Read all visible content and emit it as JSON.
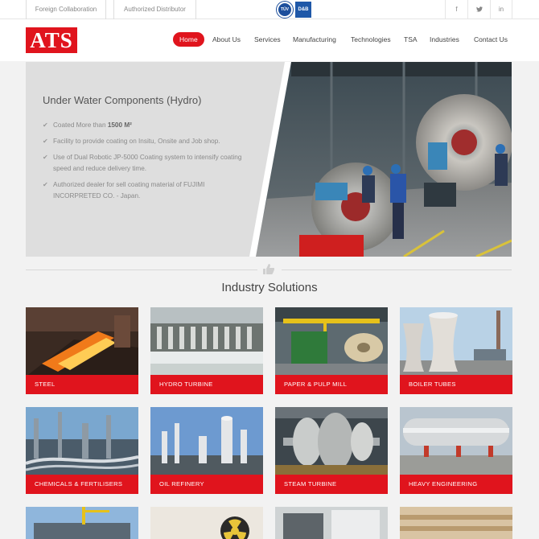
{
  "topbar": {
    "links": [
      "Foreign Collaboration",
      "Authorized Distributor"
    ],
    "certs": [
      "TÜV",
      "D&B"
    ],
    "social": [
      "f",
      "t",
      "in"
    ]
  },
  "header": {
    "logo": "ATS",
    "nav": [
      "Home",
      "About Us",
      "Services",
      "Manufacturing",
      "Technologies",
      "TSA",
      "Industries",
      "Contact Us"
    ],
    "active_nav": "Home"
  },
  "hero": {
    "title": "Under Water Components (Hydro)",
    "bullets": [
      {
        "pre": "Coated More than ",
        "bold": "1500 M²",
        "post": ""
      },
      {
        "pre": "Facility to provide coating on Insitu, Onsite and Job shop.",
        "bold": "",
        "post": ""
      },
      {
        "pre": "Use of Dual Robotic JP-5000 Coating system to intensify coating speed and reduce delivery time.",
        "bold": "",
        "post": ""
      },
      {
        "pre": "Authorized dealer for sell coating material of FUJIMI INCORPRETED CO. - Japan.",
        "bold": "",
        "post": ""
      }
    ]
  },
  "section": {
    "title": "Industry Solutions"
  },
  "industries": [
    {
      "label": "STEEL"
    },
    {
      "label": "HYDRO TURBINE"
    },
    {
      "label": "PAPER & PULP MILL"
    },
    {
      "label": "BOILER TUBES"
    },
    {
      "label": "CHEMICALS & FERTILISERS"
    },
    {
      "label": "OIL REFINERY"
    },
    {
      "label": "STEAM TURBINE"
    },
    {
      "label": "HEAVY ENGINEERING"
    }
  ],
  "colors": {
    "accent": "#e0141d",
    "background": "#f2f2f2"
  }
}
